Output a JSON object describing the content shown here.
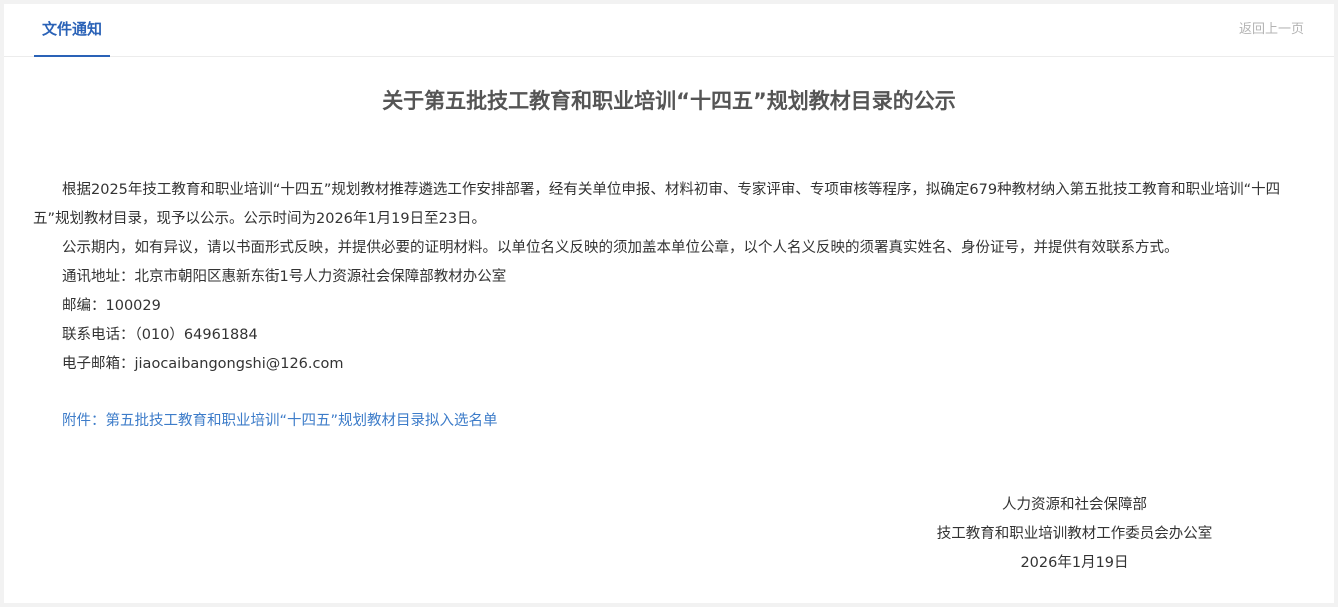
{
  "header": {
    "active_tab": "文件通知",
    "back_link": "返回上一页"
  },
  "article": {
    "title": "关于第五批技工教育和职业培训“十四五”规划教材目录的公示",
    "paragraphs": [
      "根据2025年技工教育和职业培训“十四五”规划教材推荐遴选工作安排部署，经有关单位申报、材料初审、专家评审、专项审核等程序，拟确定679种教材纳入第五批技工教育和职业培训“十四五”规划教材目录，现予以公示。公示时间为2026年1月19日至23日。",
      "公示期内，如有异议，请以书面形式反映，并提供必要的证明材料。以单位名义反映的须加盖本单位公章，以个人名义反映的须署真实姓名、身份证号，并提供有效联系方式。",
      "通讯地址：北京市朝阳区惠新东街1号人力资源社会保障部教材办公室",
      "邮编：100029",
      "联系电话：（010）64961884",
      "电子邮箱：jiaocaibangongshi@126.com"
    ],
    "attachment": "附件：第五批技工教育和职业培训“十四五”规划教材目录拟入选名单",
    "signature": {
      "org": "人力资源和社会保障部",
      "office": "技工教育和职业培训教材工作委员会办公室",
      "date": "2026年1月19日"
    }
  }
}
